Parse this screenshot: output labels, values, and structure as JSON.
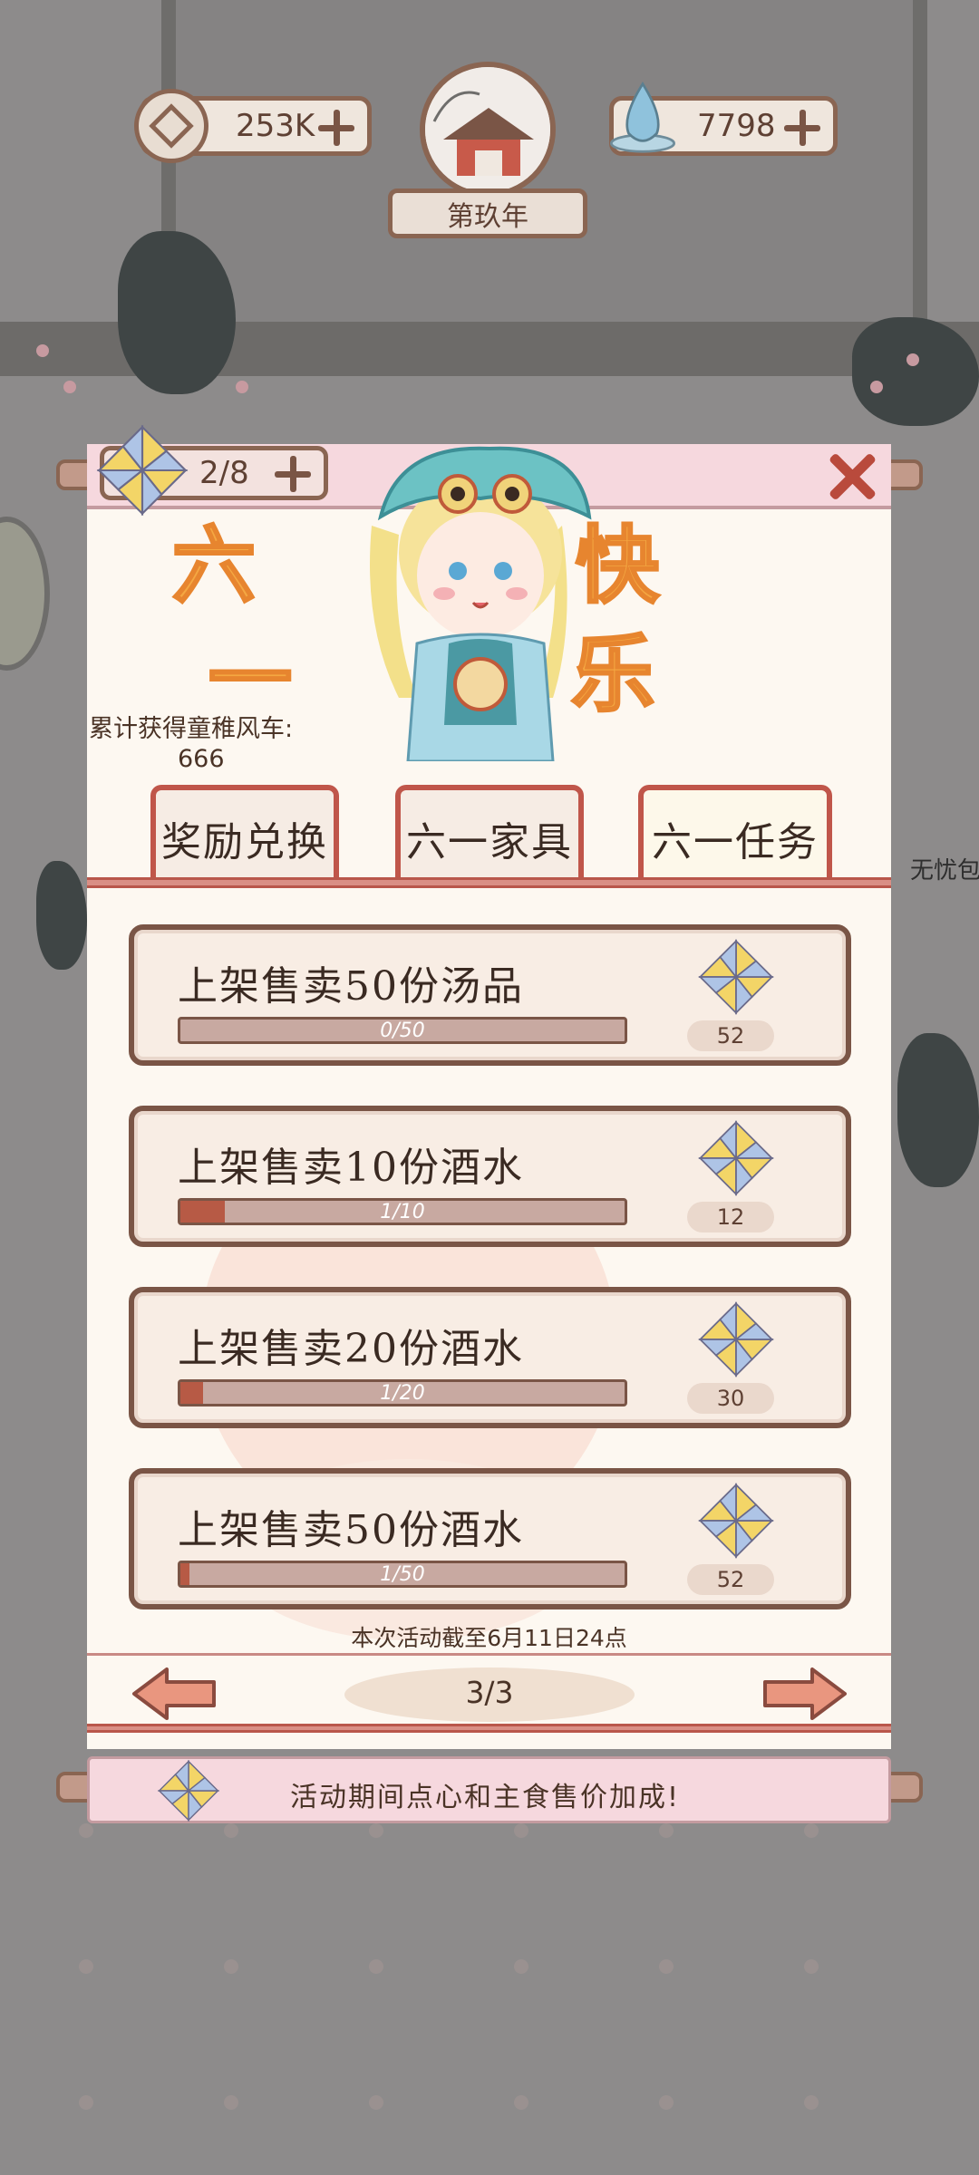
{
  "resources": {
    "coins": "253K",
    "water": "7798",
    "year_label": "第玖年",
    "coin_icon": "coin-icon",
    "water_icon": "water-drop-icon"
  },
  "panel": {
    "pinwheel_counter": "2/8",
    "banner_chars": [
      "六",
      "一",
      "快",
      "乐"
    ],
    "stat_label": "累计获得童稚风车:",
    "stat_value": "666",
    "tabs": [
      {
        "label": "奖励兑换",
        "active": false
      },
      {
        "label": "六一家具",
        "active": false
      },
      {
        "label": "六一任务",
        "active": true
      }
    ],
    "tasks": [
      {
        "title": "上架售卖50份汤品",
        "progress_text": "0/50",
        "progress": 0.0,
        "reward": "52"
      },
      {
        "title": "上架售卖10份酒水",
        "progress_text": "1/10",
        "progress": 0.1,
        "reward": "12"
      },
      {
        "title": "上架售卖20份酒水",
        "progress_text": "1/20",
        "progress": 0.05,
        "reward": "30"
      },
      {
        "title": "上架售卖50份酒水",
        "progress_text": "1/50",
        "progress": 0.02,
        "reward": "52"
      }
    ],
    "deadline": "本次活动截至6月11日24点",
    "page": "3/3",
    "footer": "活动期间点心和主食售价加成!"
  },
  "side_label": "无忧包",
  "colors": {
    "accent": "#c0564a",
    "panel": "#fdf8f1",
    "pink": "#f6d8de",
    "bar_fill": "#b75a45"
  }
}
